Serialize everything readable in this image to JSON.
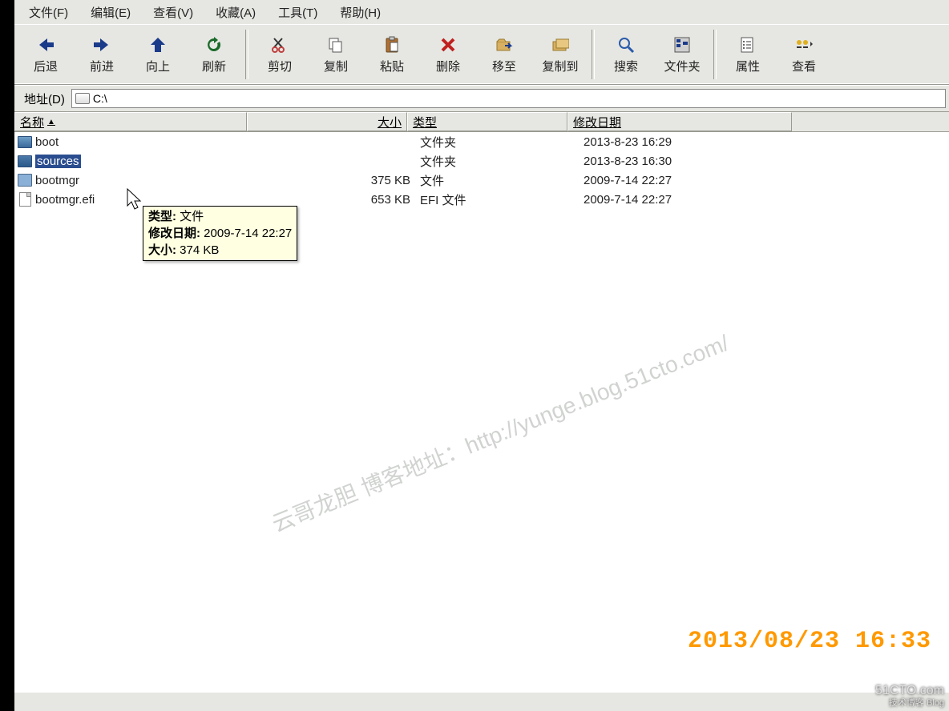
{
  "menu": {
    "file": "文件(F)",
    "edit": "编辑(E)",
    "view": "查看(V)",
    "favorites": "收藏(A)",
    "tools": "工具(T)",
    "help": "帮助(H)"
  },
  "toolbar": {
    "back": "后退",
    "forward": "前进",
    "up": "向上",
    "refresh": "刷新",
    "cut": "剪切",
    "copy": "复制",
    "paste": "粘贴",
    "delete": "删除",
    "moveto": "移至",
    "copyto": "复制到",
    "search": "搜索",
    "folders": "文件夹",
    "properties": "属性",
    "views": "查看"
  },
  "addressbar": {
    "label": "地址(D)",
    "value": "C:\\"
  },
  "columns": {
    "name": "名称",
    "size": "大小",
    "type": "类型",
    "date": "修改日期"
  },
  "files": [
    {
      "name": "boot",
      "size": "",
      "type": "文件夹",
      "date": "2013-8-23 16:29",
      "icon": "folder",
      "selected": false
    },
    {
      "name": "sources",
      "size": "",
      "type": "文件夹",
      "date": "2013-8-23 16:30",
      "icon": "folder-open",
      "selected": true
    },
    {
      "name": "bootmgr",
      "size": "375 KB",
      "type": "文件",
      "date": "2009-7-14 22:27",
      "icon": "exe",
      "selected": false
    },
    {
      "name": "bootmgr.efi",
      "size": "653 KB",
      "type": "EFI 文件",
      "date": "2009-7-14 22:27",
      "icon": "file",
      "selected": false
    }
  ],
  "tooltip": {
    "type_label": "类型:",
    "type_value": "文件",
    "date_label": "修改日期:",
    "date_value": "2009-7-14 22:27",
    "size_label": "大小:",
    "size_value": "374 KB"
  },
  "watermark": "云哥龙胆 博客地址：http://yunge.blog.51cto.com/",
  "photo_timestamp": "2013/08/23 16:33",
  "blog_brand": "51CTO.com",
  "blog_brand_sub": "技术博客  Blog"
}
